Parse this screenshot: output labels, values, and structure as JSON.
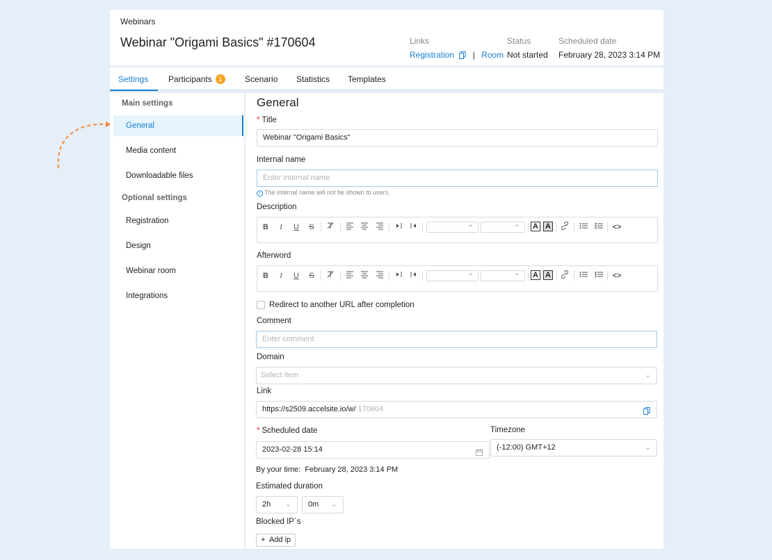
{
  "header": {
    "breadcrumb": "Webinars",
    "title": "Webinar \"Origami Basics\" #170604",
    "links_label": "Links",
    "registration_link": "Registration",
    "link_separator": "|",
    "room_link": "Room",
    "status_label": "Status",
    "status_value": "Not started",
    "scheduled_label": "Scheduled date",
    "scheduled_value": "February 28, 2023 3:14 PM"
  },
  "tabs": [
    {
      "label": "Settings",
      "active": true
    },
    {
      "label": "Participants",
      "badge": "1"
    },
    {
      "label": "Scenario"
    },
    {
      "label": "Statistics"
    },
    {
      "label": "Templates"
    }
  ],
  "sidebar": {
    "group_main": "Main settings",
    "main_items": [
      "General",
      "Media content",
      "Downloadable files"
    ],
    "group_optional": "Optional settings",
    "optional_items": [
      "Registration",
      "Design",
      "Webinar room",
      "Integrations"
    ]
  },
  "form": {
    "section_title": "General",
    "title_label": "Title",
    "title_value": "Webinar \"Origami Basics\"",
    "internal_label": "Internal name",
    "internal_placeholder": "Enter internal name",
    "internal_hint": "The internal name will not be shown to users.",
    "description_label": "Description",
    "afterword_label": "Afterword",
    "redirect_label": "Redirect to another URL after completion",
    "comment_label": "Comment",
    "comment_placeholder": "Enter comment",
    "domain_label": "Domain",
    "domain_placeholder": "Select item",
    "link_label": "Link",
    "link_prefix": "https://s2509.accelsite.io/w/",
    "link_suffix": "170604",
    "scheduled_label": "Scheduled date",
    "scheduled_value": "2023-02-28 15:14",
    "timezone_label": "Timezone",
    "timezone_value": "(-12:00) GMT+12",
    "your_time_label": "By your time:",
    "your_time_value": "February 28, 2023 3:14 PM",
    "duration_label": "Estimated duration",
    "duration_hours": "2h",
    "duration_minutes": "0m",
    "blocked_label": "Blocked IP`s",
    "add_ip": "Add ip"
  },
  "editor_toolbar": {
    "bold": "B",
    "italic": "I",
    "underline": "U",
    "strike": "S",
    "font_color": "A",
    "bg_color": "A",
    "source": "<>"
  },
  "colors": {
    "accent": "#1a7ed1",
    "background": "#e6eef7",
    "badge": "#f5a623",
    "arrow": "#f0893a",
    "required": "#e23"
  }
}
